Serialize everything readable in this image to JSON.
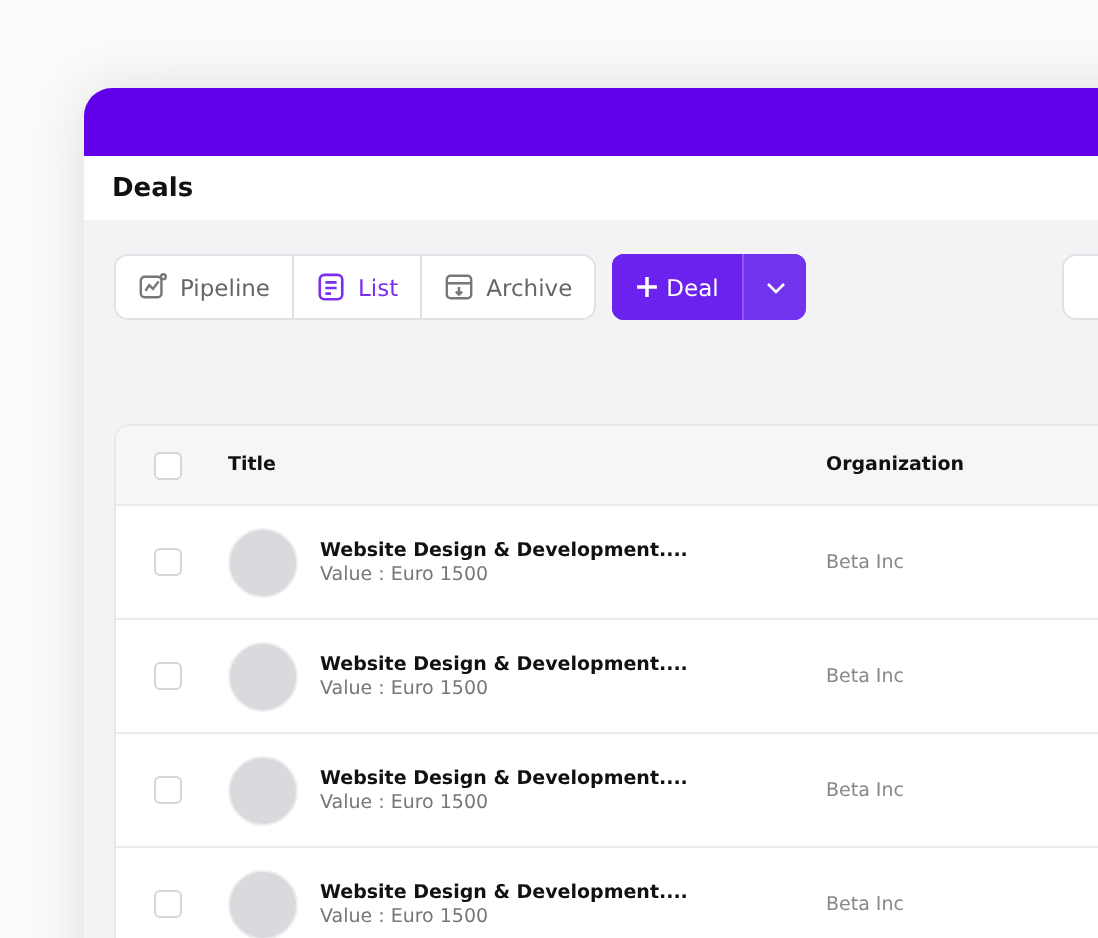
{
  "page": {
    "title": "Deals"
  },
  "view_tabs": [
    {
      "label": "Pipeline",
      "kind": "pipeline",
      "selected": false
    },
    {
      "label": "List",
      "kind": "list",
      "selected": true
    },
    {
      "label": "Archive",
      "kind": "archive",
      "selected": false
    }
  ],
  "add_button": {
    "label": "Deal"
  },
  "table": {
    "columns": [
      "Title",
      "Organization"
    ],
    "header_checked": false,
    "rows": [
      {
        "title": "Website Design & Development....",
        "value": "Value : Euro 1500",
        "organization": "Beta Inc",
        "checked": false
      },
      {
        "title": "Website Design & Development....",
        "value": "Value : Euro 1500",
        "organization": "Beta Inc",
        "checked": false
      },
      {
        "title": "Website Design & Development....",
        "value": "Value : Euro 1500",
        "organization": "Beta Inc",
        "checked": false
      },
      {
        "title": "Website Design & Development....",
        "value": "Value : Euro 1500",
        "organization": "Beta Inc",
        "checked": false
      }
    ]
  }
}
